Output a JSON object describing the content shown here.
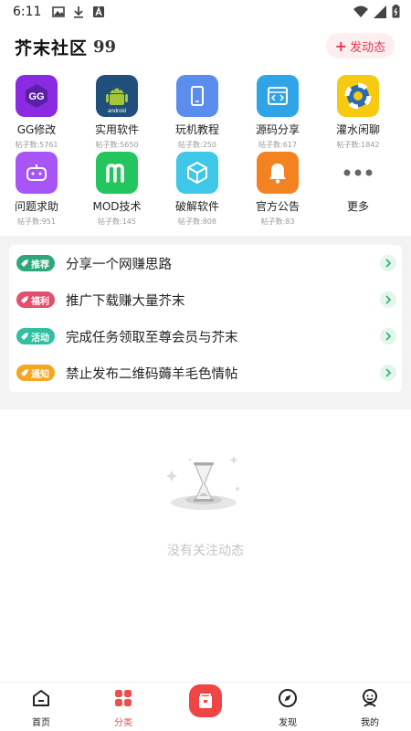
{
  "status_bar": {
    "time": "6:11"
  },
  "header": {
    "title": "芥末社区",
    "quote_mark": "99",
    "post_button": "发动态"
  },
  "categories": [
    {
      "name": "GG修改",
      "count": "帖子数:5761",
      "color": "#8a2be2",
      "icon": "gg-logo-icon"
    },
    {
      "name": "实用软件",
      "count": "帖子数:5650",
      "color": "#1f4f7a",
      "icon": "android-icon"
    },
    {
      "name": "玩机教程",
      "count": "帖子数:250",
      "color": "#5b8def",
      "icon": "phone-icon"
    },
    {
      "name": "源码分享",
      "count": "帖子数:617",
      "color": "#2fa4e7",
      "icon": "code-icon"
    },
    {
      "name": "灌水闲聊",
      "count": "帖子数:1842",
      "color": "#f7c910",
      "icon": "lifebuoy-icon"
    },
    {
      "name": "问题求助",
      "count": "帖子数:951",
      "color": "#a855f7",
      "icon": "gamepad-icon"
    },
    {
      "name": "MOD技术",
      "count": "帖子数:145",
      "color": "#22c55e",
      "icon": "mod-m-icon"
    },
    {
      "name": "破解软件",
      "count": "帖子数:808",
      "color": "#3ec7e8",
      "icon": "cube-icon"
    },
    {
      "name": "官方公告",
      "count": "帖子数:83",
      "color": "#f58220",
      "icon": "bell-icon"
    },
    {
      "name": "更多",
      "count": "",
      "color": "#777777",
      "icon": "more-dots-icon"
    }
  ],
  "notices": [
    {
      "tag": "推荐",
      "tag_color": "#2ea87a",
      "text": "分享一个网赚思路"
    },
    {
      "tag": "福利",
      "tag_color": "#e54f6d",
      "text": "推广下载赚大量芥末"
    },
    {
      "tag": "活动",
      "tag_color": "#2ec0a0",
      "text": "完成任务领取至尊会员与芥末"
    },
    {
      "tag": "通知",
      "tag_color": "#f5a623",
      "text": "禁止发布二维码薅羊毛色情帖"
    }
  ],
  "empty_state": {
    "message": "没有关注动态"
  },
  "bottom_nav": [
    {
      "label": "首页",
      "icon": "home-icon",
      "active": false
    },
    {
      "label": "分类",
      "icon": "grid-icon",
      "active": true
    },
    {
      "label": "",
      "icon": "post-center-icon",
      "active": false
    },
    {
      "label": "发现",
      "icon": "compass-icon",
      "active": false
    },
    {
      "label": "我的",
      "icon": "profile-icon",
      "active": false
    }
  ],
  "colors": {
    "accent": "#f04545",
    "active_tab": "#f04d4d"
  }
}
